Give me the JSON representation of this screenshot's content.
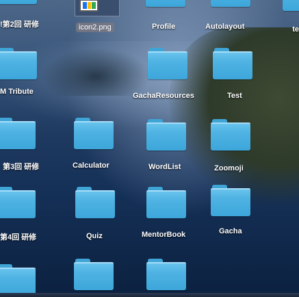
{
  "desktop": {
    "png_file": {
      "label": "icon2.png",
      "icon": "image-file-icon"
    },
    "partial_text": "te",
    "folders": [
      {
        "label": "Profile"
      },
      {
        "label": "Autolayout"
      },
      {
        "label": "!第2回 研修"
      },
      {
        "label": "M Tribute"
      },
      {
        "label": "GachaResources"
      },
      {
        "label": "Test"
      },
      {
        "label": "第3回 研修"
      },
      {
        "label": "Calculator"
      },
      {
        "label": "WordList"
      },
      {
        "label": "Zoomoji"
      },
      {
        "label": "第4回 研修"
      },
      {
        "label": "Quiz"
      },
      {
        "label": "MentorBook"
      },
      {
        "label": "Gacha"
      }
    ]
  }
}
